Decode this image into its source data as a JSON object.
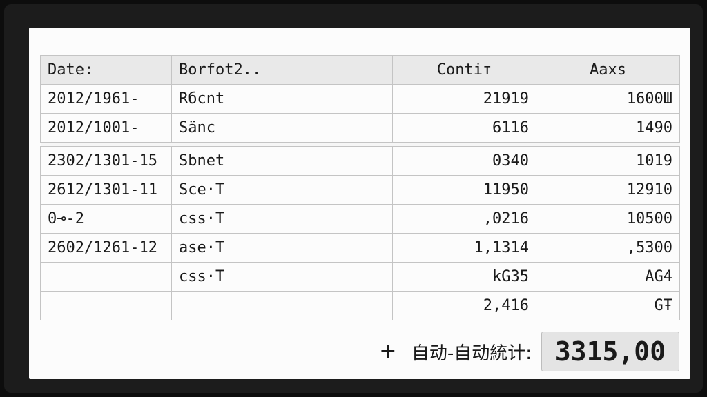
{
  "table": {
    "headers": [
      "Date:",
      "Borfot2..",
      "Contiт",
      "Aaxs"
    ],
    "rows_top": [
      [
        "2012/1961-",
        "Rбcnt",
        "21919",
        "1600Ш"
      ],
      [
        "2012/1001-",
        "Sänc",
        "6116",
        "1490"
      ]
    ],
    "rows_bottom": [
      [
        "2302/1301-15",
        "Sbnet",
        "0340",
        "1019"
      ],
      [
        "2612/1301-11",
        "Sce·T",
        "11950",
        "12910"
      ],
      [
        "0⊸-2",
        "css·T",
        ",0216",
        "10500"
      ],
      [
        "2602/1261-12",
        "ase·T",
        "1,1314",
        ",5300"
      ],
      [
        "",
        "css·T",
        "kG35",
        "AG4"
      ],
      [
        "",
        "",
        "2,416",
        "GŦ"
      ]
    ]
  },
  "footer": {
    "add_symbol": "+",
    "total_label": "自动-自动統计:",
    "total_value": "3315,00"
  }
}
